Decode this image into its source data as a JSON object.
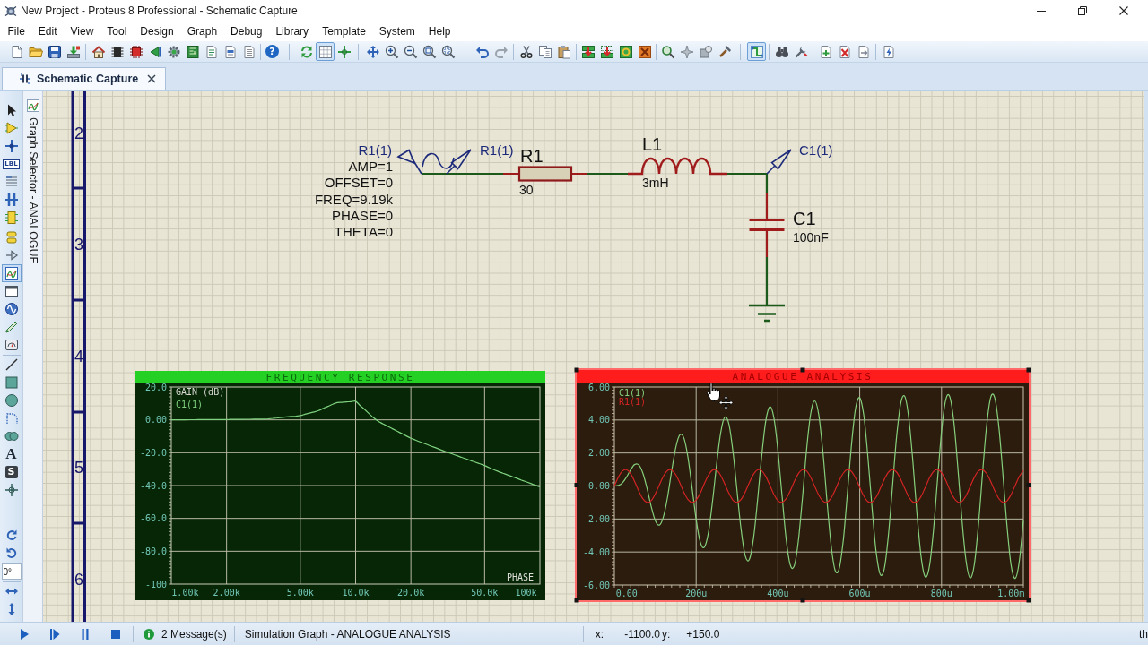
{
  "window": {
    "title": "New Project - Proteus 8 Professional - Schematic Capture"
  },
  "menu": [
    "File",
    "Edit",
    "View",
    "Tool",
    "Design",
    "Graph",
    "Debug",
    "Library",
    "Template",
    "System",
    "Help"
  ],
  "toolbar": [
    [
      {
        "pressed": false
      },
      {
        "pressed": false
      },
      {
        "pressed": false
      },
      {
        "pressed": false
      }
    ],
    [
      {
        "pressed": false
      },
      {
        "pressed": false
      },
      {
        "pressed": false
      },
      {
        "pressed": false
      },
      {
        "pressed": false
      },
      {
        "pressed": false
      },
      {
        "pressed": false
      },
      {
        "pressed": false
      },
      {
        "pressed": false
      }
    ],
    [
      {
        "pressed": false,
        "glyph": "?"
      }
    ],
    [
      {
        "pressed": false
      },
      {
        "pressed": true
      },
      {
        "pressed": false
      }
    ],
    [
      {
        "pressed": false
      },
      {
        "pressed": false
      },
      {
        "pressed": false
      },
      {
        "pressed": false
      },
      {
        "pressed": false
      }
    ],
    [
      {
        "pressed": false
      },
      {
        "pressed": false
      }
    ],
    [
      {
        "pressed": false
      },
      {
        "pressed": false
      },
      {
        "pressed": false
      }
    ],
    [
      {
        "pressed": false
      },
      {
        "pressed": false
      },
      {
        "pressed": false
      },
      {
        "pressed": false
      }
    ],
    [
      {
        "pressed": false
      },
      {
        "pressed": false
      },
      {
        "pressed": false
      },
      {
        "pressed": false
      }
    ],
    [
      {
        "pressed": true
      }
    ],
    [
      {
        "pressed": false
      },
      {
        "pressed": false
      }
    ],
    [
      {
        "pressed": false
      },
      {
        "pressed": false
      },
      {
        "pressed": false
      }
    ],
    [
      {
        "pressed": false
      }
    ]
  ],
  "tabs": [
    {
      "label": "Schematic Capture",
      "selected": true
    }
  ],
  "mode_toolbar": [
    [
      {
        "selected": false
      },
      {
        "selected": false
      },
      {
        "selected": false
      },
      {
        "selected": false,
        "glyph": "LBL"
      },
      {
        "selected": false
      },
      {
        "selected": false
      },
      {
        "selected": false
      }
    ],
    [
      {
        "selected": false
      },
      {
        "selected": false
      },
      {
        "selected": true
      },
      {
        "selected": false
      },
      {
        "selected": false
      },
      {
        "selected": false
      },
      {
        "selected": false
      }
    ],
    [
      {
        "selected": false
      },
      {
        "selected": false
      },
      {
        "selected": false
      },
      {
        "selected": false
      },
      {
        "selected": false
      },
      {
        "selected": false,
        "glyph": "A"
      },
      {
        "selected": false,
        "glyph": "S"
      },
      {
        "selected": false
      }
    ]
  ],
  "orientation": {
    "angle": "0°"
  },
  "panel_tab": {
    "label": "Graph Selector - ANALOGUE"
  },
  "sheet": {
    "zone_labels": [
      "2",
      "3",
      "4",
      "5",
      "6"
    ]
  },
  "circuit": {
    "generator": {
      "label": "R1(1)",
      "properties": [
        "AMP=1",
        "OFFSET=0",
        "FREQ=9.19k",
        "PHASE=0",
        "THETA=0"
      ]
    },
    "components": [
      {
        "kind": "resistor",
        "ref": "R1",
        "value": "30"
      },
      {
        "kind": "inductor",
        "ref": "L1",
        "value": "3mH"
      },
      {
        "kind": "capacitor",
        "ref": "C1",
        "value": "100nF"
      }
    ],
    "probes": [
      {
        "label": "R1(1)"
      },
      {
        "label": "C1(1)"
      }
    ]
  },
  "graphs": [
    {
      "selected": false,
      "right_label": "PHASE",
      "chart_data": {
        "type": "line",
        "title": "FREQUENCY RESPONSE",
        "ylabel": "GAIN (dB)",
        "grid": true,
        "categories": [
          null,
          null,
          null,
          "1.00k",
          null,
          null,
          null,
          null,
          null,
          null,
          null,
          null,
          "2.00k",
          null,
          null,
          null,
          null,
          null,
          null,
          null,
          null,
          null,
          null,
          null,
          null,
          null,
          null,
          null,
          "5.00k",
          null,
          null,
          null,
          null,
          null,
          null,
          null,
          null,
          null,
          null,
          null,
          "10.0k",
          null,
          null,
          null,
          null,
          null,
          null,
          null,
          null,
          null,
          null,
          null,
          "20.0k",
          null,
          null,
          null,
          null,
          null,
          null,
          null,
          null,
          null,
          null,
          null,
          null,
          null,
          null,
          null,
          "50.0k",
          null,
          null,
          null,
          null,
          null,
          null,
          null,
          null,
          "100k",
          null,
          null,
          null
        ],
        "series": [
          {
            "name": "C1(1)",
            "color": "#7fd07f",
            "values": [
              0,
              0.02,
              0.04,
              0.06,
              0.08,
              0.1,
              0.12,
              0.13,
              0.15,
              0.16,
              0.17,
              0.19,
              0.2,
              0.23,
              0.27,
              0.31,
              0.34,
              0.38,
              0.41,
              0.45,
              0.48,
              0.65,
              0.93,
              1.2,
              1.5,
              1.8,
              2.1,
              2.3,
              2.6,
              3.4,
              4.1,
              4.8,
              5.7,
              7,
              8.2,
              9.5,
              10.5,
              10.7,
              10.9,
              11.1,
              11.3,
              8.7,
              6.2,
              3.6,
              1,
              -1,
              -2.5,
              -4,
              -5.4,
              -6.9,
              -8.3,
              -9.8,
              -11.2,
              -12.3,
              -13.4,
              -14.5,
              -15.6,
              -16.6,
              -17.7,
              -18.8,
              -19.8,
              -20.8,
              -21.8,
              -22.8,
              -23.8,
              -24.8,
              -25.8,
              -26.8,
              -27.8,
              -29.1,
              -30.3,
              -31.5,
              -32.5,
              -33.5,
              -34.6,
              -35.6,
              -36.7,
              -37.7,
              -38.7,
              -39.8,
              -40.8
            ]
          }
        ],
        "ylim": [
          -100,
          20
        ],
        "yticks": [
          {
            "value": 20,
            "label": "20.0"
          },
          {
            "value": 0,
            "label": "0.00"
          },
          {
            "value": -20,
            "label": "-20.0"
          },
          {
            "value": -40,
            "label": "-40.0"
          },
          {
            "value": -60,
            "label": "-60.0"
          },
          {
            "value": -80,
            "label": "-80.0"
          },
          {
            "value": -100,
            "label": "-100"
          }
        ]
      }
    },
    {
      "selected": true,
      "chart_data": {
        "type": "line",
        "title": "ANALOGUE ANALYSIS",
        "grid": true,
        "categories": [
          null,
          null,
          null,
          "0.00",
          null,
          null,
          null,
          null,
          null,
          null,
          null,
          null,
          null,
          null,
          null,
          null,
          null,
          null,
          null,
          null,
          "200u",
          null,
          null,
          null,
          null,
          null,
          null,
          null,
          null,
          null,
          null,
          null,
          null,
          null,
          null,
          null,
          null,
          null,
          null,
          null,
          "400u",
          null,
          null,
          null,
          null,
          null,
          null,
          null,
          null,
          null,
          null,
          null,
          null,
          null,
          null,
          null,
          null,
          null,
          null,
          null,
          "600u",
          null,
          null,
          null,
          null,
          null,
          null,
          null,
          null,
          null,
          null,
          null,
          null,
          null,
          null,
          null,
          null,
          null,
          null,
          null,
          "800u",
          null,
          null,
          null,
          null,
          null,
          null,
          null,
          null,
          null,
          null,
          null,
          null,
          null,
          null,
          null,
          null,
          "1.00m",
          null,
          null,
          null
        ],
        "series": [
          {
            "name": "C1(1)",
            "color": "#86cf7c",
            "values": [
              0,
              0.03,
              0.2,
              0.55,
              0.99,
              1.31,
              1.27,
              0.76,
              -0.16,
              -1.23,
              -2.09,
              -2.37,
              -1.87,
              -0.68,
              0.89,
              2.32,
              3.1,
              2.91,
              1.73,
              -0.1,
              -2.03,
              -3.4,
              -3.71,
              -2.82,
              -0.95,
              1.31,
              3.24,
              4.17,
              3.76,
              2.1,
              -0.3,
              -2.67,
              -4.23,
              -4.45,
              -3.22,
              -0.9,
              1.76,
              3.9,
              4.8,
              4.16,
              2.14,
              -0.6,
              -3.2,
              -4.78,
              -4.83,
              -3.3,
              -0.69,
              2.19,
              4.37,
              5.16,
              4.28,
              2.03,
              -0.92,
              -3.6,
              -5.12,
              -4.99,
              -3.23,
              -0.41,
              2.56,
              4.72,
              5.35,
              4.25,
              1.76,
              -1.31,
              -3.97,
              -5.35,
              -5,
              -3.02,
              -0.05,
              2.94,
              4.99,
              5.43,
              4.1,
              1.44,
              -1.7,
              -4.28,
              -5.5,
              -4.92,
              -2.75,
              0.32,
              3.29,
              5.2,
              5.42,
              3.89,
              1.09,
              -2.07,
              -4.56,
              -5.57,
              -4.78,
              -2.44,
              0.7,
              3.61,
              5.36,
              5.36,
              3.63,
              0.72,
              -2.43,
              -4.79,
              -5.6,
              -4.6,
              -2.1
            ]
          },
          {
            "name": "R1(1)",
            "color": "#d42424",
            "values": [
              0,
              0.55,
              0.92,
              0.99,
              0.74,
              0.25,
              -0.32,
              -0.78,
              -1,
              -0.89,
              -0.49,
              0.07,
              0.6,
              0.94,
              0.97,
              0.69,
              0.19,
              -0.38,
              -0.82,
              -1,
              -0.85,
              -0.43,
              0.14,
              0.65,
              0.96,
              0.96,
              0.64,
              0.12,
              -0.44,
              -0.86,
              -1,
              -0.81,
              -0.37,
              0.2,
              0.7,
              0.98,
              0.93,
              0.59,
              0.05,
              -0.5,
              -0.89,
              -0.99,
              -0.77,
              -0.3,
              0.27,
              0.75,
              0.99,
              0.91,
              0.53,
              -0.02,
              -0.56,
              -0.92,
              -0.98,
              -0.73,
              -0.24,
              0.33,
              0.79,
              1,
              0.88,
              0.47,
              -0.08,
              -0.61,
              -0.95,
              -0.97,
              -0.68,
              -0.17,
              0.4,
              0.83,
              1,
              0.84,
              0.41,
              -0.15,
              -0.67,
              -0.97,
              -0.95,
              -0.63,
              -0.1,
              0.46,
              0.87,
              1,
              0.81,
              0.35,
              -0.22,
              -0.72,
              -0.98,
              -0.93,
              -0.58,
              -0.04,
              0.52,
              0.9,
              0.99,
              0.76,
              0.29,
              -0.28,
              -0.76,
              -0.99,
              -0.9,
              -0.52,
              0.03,
              0.57,
              0.93
            ]
          }
        ],
        "ylim": [
          -6,
          6
        ],
        "yticks": [
          {
            "value": 6,
            "label": "6.00"
          },
          {
            "value": 4,
            "label": "4.00"
          },
          {
            "value": 2,
            "label": "2.00"
          },
          {
            "value": 0,
            "label": "0.00"
          },
          {
            "value": -2,
            "label": "-2.00"
          },
          {
            "value": -4,
            "label": "-4.00"
          },
          {
            "value": -6,
            "label": "-6.00"
          }
        ]
      }
    }
  ],
  "status_bar": {
    "messages": "2 Message(s)",
    "status": "Simulation Graph - ANALOGUE ANALYSIS",
    "x_label": "x:",
    "x_value": "-1100.0",
    "y_label": "y:",
    "y_value": "+150.0",
    "trailing": "th"
  }
}
